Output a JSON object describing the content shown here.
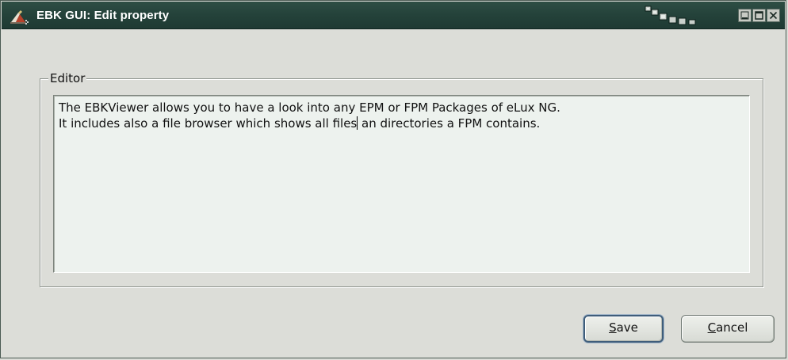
{
  "window": {
    "title": "EBK GUI: Edit property",
    "icons": {
      "app": "ebk-app-icon",
      "decoration": "windows-cascade-icon",
      "minimize": "minimize-icon",
      "maximize": "maximize-icon",
      "close": "close-icon"
    },
    "colors": {
      "titlebar": "#24423a",
      "title_text": "#ffffff",
      "background": "#dcddd8",
      "editor_background": "#edf2ee",
      "default_button_border": "#3f5d7a"
    }
  },
  "editor_group": {
    "legend": "Editor",
    "text_line_1": "The EBKViewer allows you to have a look into any EPM or FPM Packages of eLux NG.",
    "text_line_2_before_caret": "It includes also a file browser which shows all files",
    "text_line_2_after_caret": " an directories a FPM contains."
  },
  "buttons": {
    "save": {
      "mnemonic": "S",
      "rest": "ave"
    },
    "cancel": {
      "mnemonic": "C",
      "rest": "ancel"
    }
  }
}
